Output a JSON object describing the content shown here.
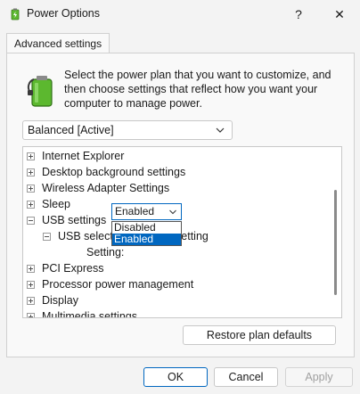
{
  "window": {
    "title": "Power Options",
    "help_glyph": "?",
    "close_glyph": "✕"
  },
  "tab": {
    "label": "Advanced settings"
  },
  "description": "Select the power plan that you want to customize, and then choose settings that reflect how you want your computer to manage power.",
  "plan_select": {
    "value": "Balanced [Active]"
  },
  "tree": {
    "items": [
      {
        "label": "Internet Explorer",
        "expanded": false
      },
      {
        "label": "Desktop background settings",
        "expanded": false
      },
      {
        "label": "Wireless Adapter Settings",
        "expanded": false
      },
      {
        "label": "Sleep",
        "expanded": false
      },
      {
        "label": "USB settings",
        "expanded": true
      },
      {
        "label": "USB selective suspend setting",
        "expanded": true
      },
      {
        "label": "PCI Express",
        "expanded": false
      },
      {
        "label": "Processor power management",
        "expanded": false
      },
      {
        "label": "Display",
        "expanded": false
      },
      {
        "label": "Multimedia settings",
        "expanded": false
      }
    ],
    "setting_label": "Setting:",
    "setting_value": "Enabled",
    "setting_options": [
      "Disabled",
      "Enabled"
    ],
    "setting_selected_index": 1
  },
  "buttons": {
    "restore": "Restore plan defaults",
    "ok": "OK",
    "cancel": "Cancel",
    "apply": "Apply"
  },
  "colors": {
    "accent": "#0067c0",
    "battery_green": "#5cb82f"
  }
}
